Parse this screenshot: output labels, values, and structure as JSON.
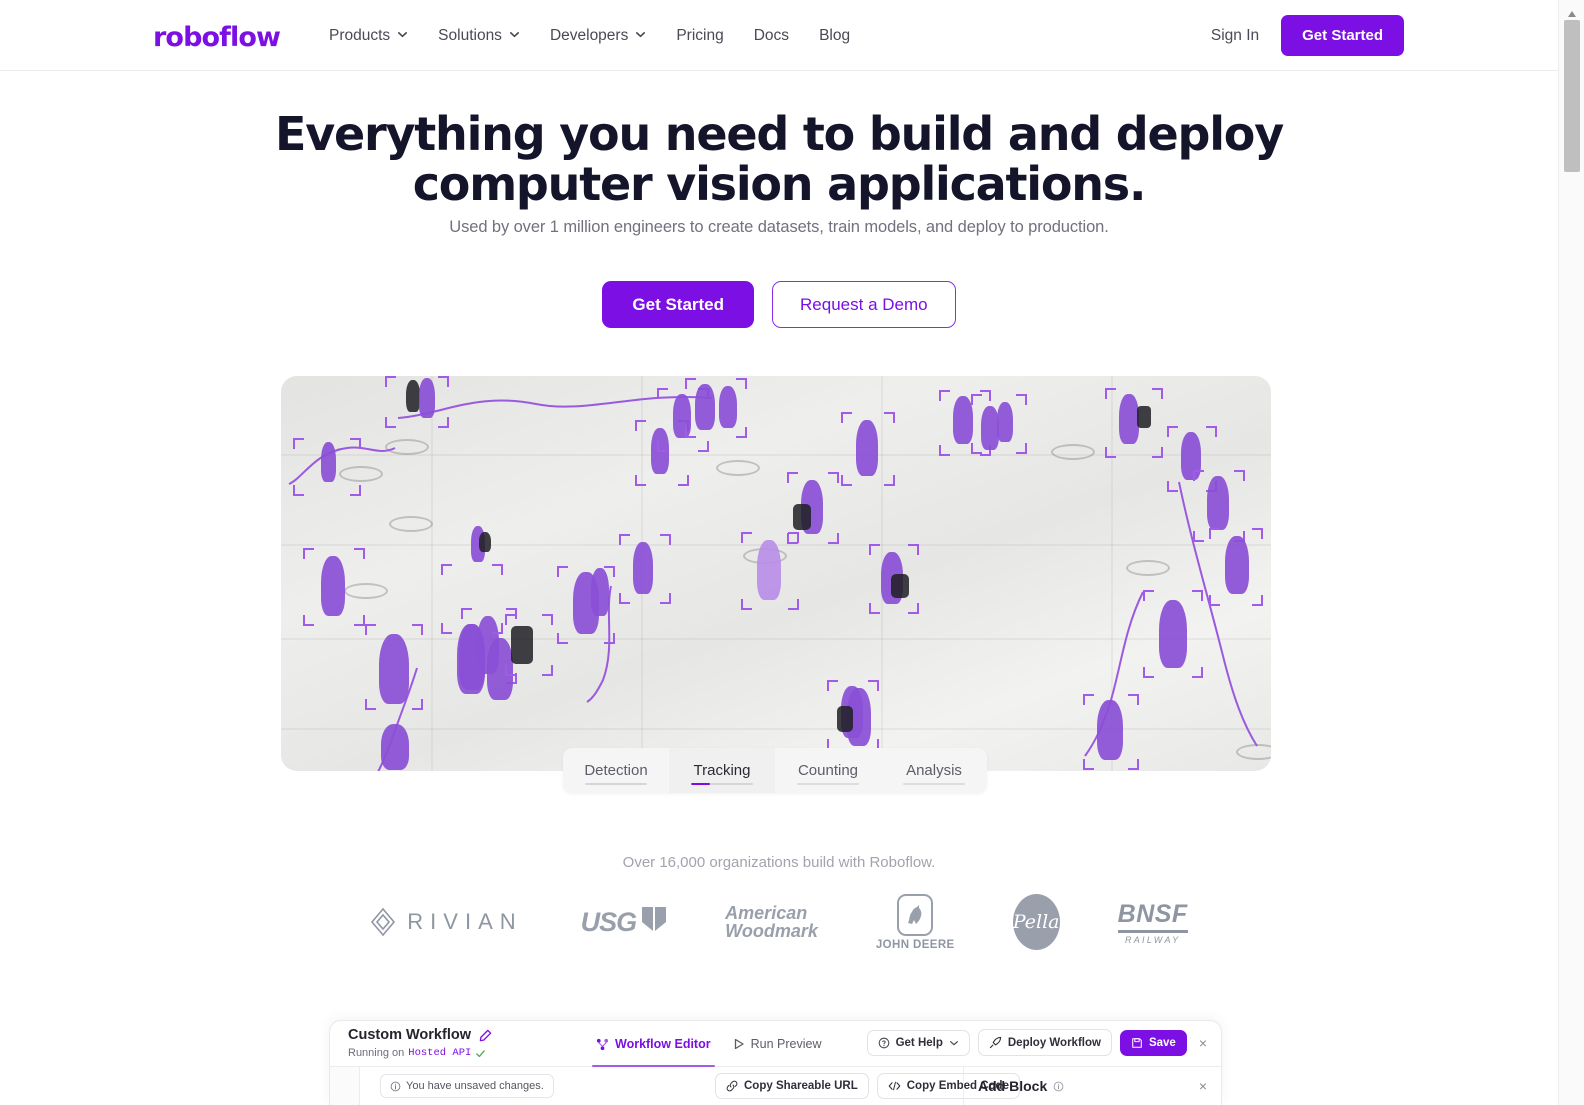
{
  "navbar": {
    "brand": "roboflow",
    "links": [
      {
        "label": "Products",
        "has_caret": true,
        "icon": "chevron-down-icon"
      },
      {
        "label": "Solutions",
        "has_caret": true,
        "icon": "chevron-down-icon"
      },
      {
        "label": "Developers",
        "has_caret": true,
        "icon": "chevron-down-icon"
      },
      {
        "label": "Pricing",
        "has_caret": false
      },
      {
        "label": "Docs",
        "has_caret": false
      },
      {
        "label": "Blog",
        "has_caret": false
      }
    ],
    "sign_in": "Sign In",
    "get_started": "Get Started"
  },
  "hero": {
    "title_line1": "Everything you need to build and deploy",
    "title_line2": "computer vision applications.",
    "subtitle": "Used by over 1 million engineers to create datasets, train models, and deploy to production.",
    "cta_primary": "Get Started",
    "cta_secondary": "Request a Demo"
  },
  "media_tabs": {
    "items": [
      {
        "label": "Detection",
        "active": false,
        "progress": 100
      },
      {
        "label": "Tracking",
        "active": true,
        "progress": 30
      },
      {
        "label": "Counting",
        "active": false,
        "progress": 100
      },
      {
        "label": "Analysis",
        "active": false,
        "progress": 100
      }
    ]
  },
  "social_proof": {
    "note": "Over 16,000 organizations build with Roboflow.",
    "logos": [
      {
        "name": "Rivian",
        "text": "RIVIAN"
      },
      {
        "name": "USG",
        "text": "USG"
      },
      {
        "name": "American Woodmark",
        "line1": "American",
        "line2": "Woodmark"
      },
      {
        "name": "John Deere",
        "text": "JOHN DEERE"
      },
      {
        "name": "Pella",
        "text": "Pella"
      },
      {
        "name": "BNSF Railway",
        "text": "BNSF",
        "sub": "RAILWAY"
      }
    ]
  },
  "workflow": {
    "title": "Custom Workflow",
    "edit_icon": "pencil-icon",
    "running_prefix": "Running on",
    "running_target": "Hosted API",
    "tabs": [
      {
        "label": "Workflow Editor",
        "active": true,
        "icon": "workflow-icon"
      },
      {
        "label": "Run Preview",
        "active": false,
        "icon": "play-icon"
      }
    ],
    "actions": [
      {
        "label": "Get Help",
        "icon": "help-circle-icon",
        "caret": true
      },
      {
        "label": "Deploy Workflow",
        "icon": "rocket-icon",
        "caret": false
      },
      {
        "label": "Save",
        "icon": "save-disk-icon",
        "primary": true
      }
    ],
    "close_label": "×",
    "unsaved_notice": "You have unsaved changes.",
    "copy_buttons": [
      {
        "label": "Copy Shareable URL",
        "icon": "link-icon"
      },
      {
        "label": "Copy Embed Code",
        "icon": "code-icon"
      }
    ],
    "add_block": {
      "title": "Add Block",
      "info_icon": "info-circle-icon",
      "close": "×"
    }
  },
  "colors": {
    "brand_purple": "#7c0fe4",
    "heading": "#14142b",
    "muted_text": "#71717f",
    "logo_grey": "#9aa0ab"
  }
}
